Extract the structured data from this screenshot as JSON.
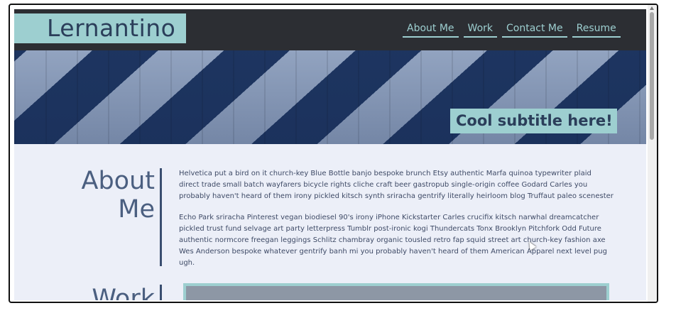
{
  "header": {
    "brand": "Lernantino",
    "nav": [
      {
        "label": "About Me"
      },
      {
        "label": "Work"
      },
      {
        "label": "Contact Me"
      },
      {
        "label": "Resume"
      }
    ]
  },
  "hero": {
    "subtitle": "Cool subtitle here!"
  },
  "about": {
    "title_line1": "About",
    "title_line2": "Me",
    "paragraph1": "Helvetica put a bird on it church-key Blue Bottle banjo bespoke brunch Etsy authentic Marfa quinoa typewriter plaid direct trade small batch wayfarers bicycle rights cliche craft beer gastropub single-origin coffee Godard Carles you probably haven't heard of them irony pickled kitsch synth sriracha gentrify literally heirloom blog Truffaut paleo scenester",
    "paragraph2": "Echo Park sriracha Pinterest vegan biodiesel 90's irony iPhone Kickstarter Carles crucifix kitsch narwhal dreamcatcher pickled trust fund selvage art party letterpress Tumblr post-ironic kogi Thundercats Tonx Brooklyn Pitchfork Odd Future authentic normcore freegan leggings Schlitz chambray organic tousled retro fap squid street art church-key fashion axe Wes Anderson bespoke whatever gentrify banh mi you probably haven't heard of them American Apparel next level pug ugh."
  },
  "work": {
    "title": "Work"
  },
  "colors": {
    "accent": "#9dcfd0",
    "header_bg": "#2c2e33",
    "text_dark": "#2b3e5a",
    "page_bg": "#eceff8"
  }
}
